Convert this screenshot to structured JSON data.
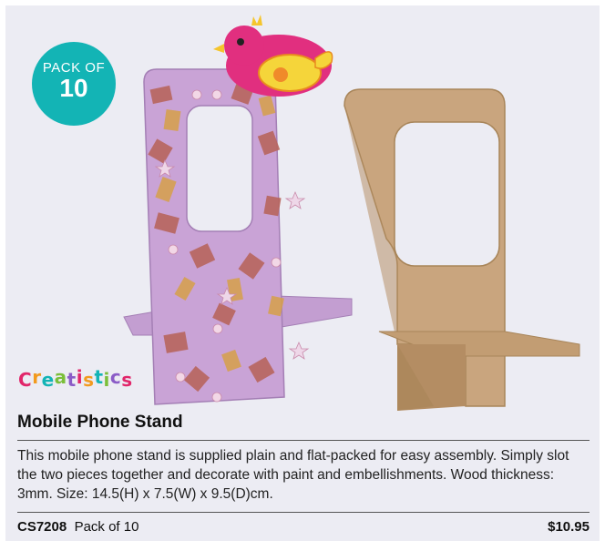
{
  "badge": {
    "line1": "PACK OF",
    "line2": "10"
  },
  "brand": {
    "logo_text": "Creatistics",
    "colors": [
      "#e1266a",
      "#f29a1f",
      "#13b4b5",
      "#7bbf3a",
      "#8b5cc7",
      "#e1266a",
      "#f29a1f",
      "#13b4b5",
      "#7bbf3a",
      "#8b5cc7",
      "#e1266a"
    ]
  },
  "product": {
    "title": "Mobile Phone Stand",
    "description": "This mobile phone stand is supplied plain and flat-packed for easy assembly. Simply slot the two pieces together and decorate with paint and embellishments. Wood thickness: 3mm. Size: 14.5(H) x 7.5(W) x 9.5(D)cm.",
    "code": "CS7208",
    "pack": "Pack of 10",
    "price": "$10.95"
  },
  "colors": {
    "background": "#ececf3",
    "badge": "#13b4b5",
    "decorated_stand": "#c9a3d6",
    "plain_stand": "#c9a57e"
  }
}
